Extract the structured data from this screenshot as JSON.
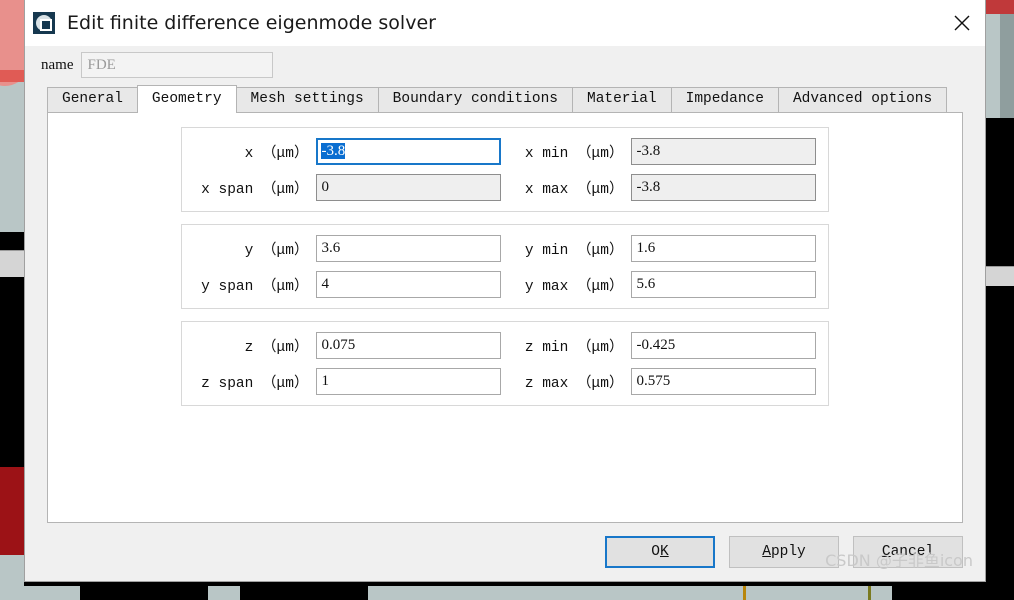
{
  "window": {
    "title": "Edit finite difference eigenmode solver",
    "icon": "fde-solver-icon",
    "close_label": "✕"
  },
  "name_field": {
    "label": "name",
    "value": "FDE",
    "placeholder": "FDE"
  },
  "tabs": [
    {
      "label": "General",
      "active": false
    },
    {
      "label": "Geometry",
      "active": true
    },
    {
      "label": "Mesh settings",
      "active": false
    },
    {
      "label": "Boundary conditions",
      "active": false
    },
    {
      "label": "Material",
      "active": false
    },
    {
      "label": "Impedance",
      "active": false
    },
    {
      "label": "Advanced options",
      "active": false
    }
  ],
  "geometry": {
    "groups": [
      {
        "axis": "x",
        "rows": [
          {
            "left_label": "x （μm）",
            "left_value": "-3.8",
            "left_state": "focused",
            "right_label": "x min （μm）",
            "right_value": "-3.8",
            "right_state": "disabled"
          },
          {
            "left_label": "x span （μm）",
            "left_value": "0",
            "left_state": "disabled",
            "right_label": "x max （μm）",
            "right_value": "-3.8",
            "right_state": "disabled"
          }
        ]
      },
      {
        "axis": "y",
        "rows": [
          {
            "left_label": "y （μm）",
            "left_value": "3.6",
            "left_state": "enabled",
            "right_label": "y min （μm）",
            "right_value": "1.6",
            "right_state": "enabled"
          },
          {
            "left_label": "y span （μm）",
            "left_value": "4",
            "left_state": "enabled",
            "right_label": "y max （μm）",
            "right_value": "5.6",
            "right_state": "enabled"
          }
        ]
      },
      {
        "axis": "z",
        "rows": [
          {
            "left_label": "z （μm）",
            "left_value": "0.075",
            "left_state": "enabled",
            "right_label": "z min （μm）",
            "right_value": "-0.425",
            "right_state": "enabled"
          },
          {
            "left_label": "z span （μm）",
            "left_value": "1",
            "left_state": "enabled",
            "right_label": "z max （μm）",
            "right_value": "0.575",
            "right_state": "enabled"
          }
        ]
      }
    ]
  },
  "footer": {
    "buttons": [
      {
        "label": "OK",
        "mnemonic_index": 1,
        "default": true
      },
      {
        "label": "Apply",
        "mnemonic_index": 0,
        "default": false
      },
      {
        "label": "Cancel",
        "mnemonic_index": 0,
        "default": false
      }
    ]
  },
  "watermark": "CSDN @子非鱼icon",
  "colors": {
    "accent_focus": "#1877c9",
    "selection": "#0a6ed1",
    "dialog_bg": "#f0f0f0",
    "panel_bg": "#ffffff",
    "disabled_field_bg": "#efefef",
    "title_icon_bg": "#16384f"
  }
}
